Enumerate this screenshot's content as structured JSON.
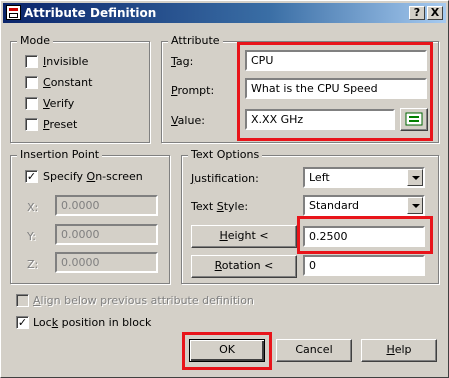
{
  "window": {
    "title": "Attribute Definition",
    "help_button": "?",
    "close_button": "X"
  },
  "mode": {
    "legend": "Mode",
    "invisible": "Invisible",
    "constant": "Constant",
    "verify": "Verify",
    "preset": "Preset"
  },
  "attribute": {
    "legend": "Attribute",
    "tag_label": "Tag:",
    "tag_value": "CPU",
    "prompt_label": "Prompt:",
    "prompt_value": "What is the CPU Speed",
    "value_label": "Value:",
    "value_value": "X.XX GHz"
  },
  "insertion_point": {
    "legend": "Insertion Point",
    "specify_on_screen": "Specify On-screen",
    "specify_checked": "✓",
    "x_label": "X:",
    "x_value": "0.0000",
    "y_label": "Y:",
    "y_value": "0.0000",
    "z_label": "Z:",
    "z_value": "0.0000"
  },
  "text_options": {
    "legend": "Text Options",
    "justification_label": "Justification:",
    "justification_value": "Left",
    "text_style_label": "Text Style:",
    "text_style_value": "Standard",
    "height_button": "Height <",
    "height_value": "0.2500",
    "rotation_button": "Rotation <",
    "rotation_value": "0"
  },
  "options": {
    "align_below": "Align below previous attribute definition",
    "lock_position": "Lock position in block",
    "lock_checked": "✓"
  },
  "buttons": {
    "ok": "OK",
    "cancel": "Cancel",
    "help": "Help"
  },
  "colors": {
    "highlight": "#e8141a",
    "titlebar": "#0a246a",
    "face": "#d4d0c8"
  }
}
